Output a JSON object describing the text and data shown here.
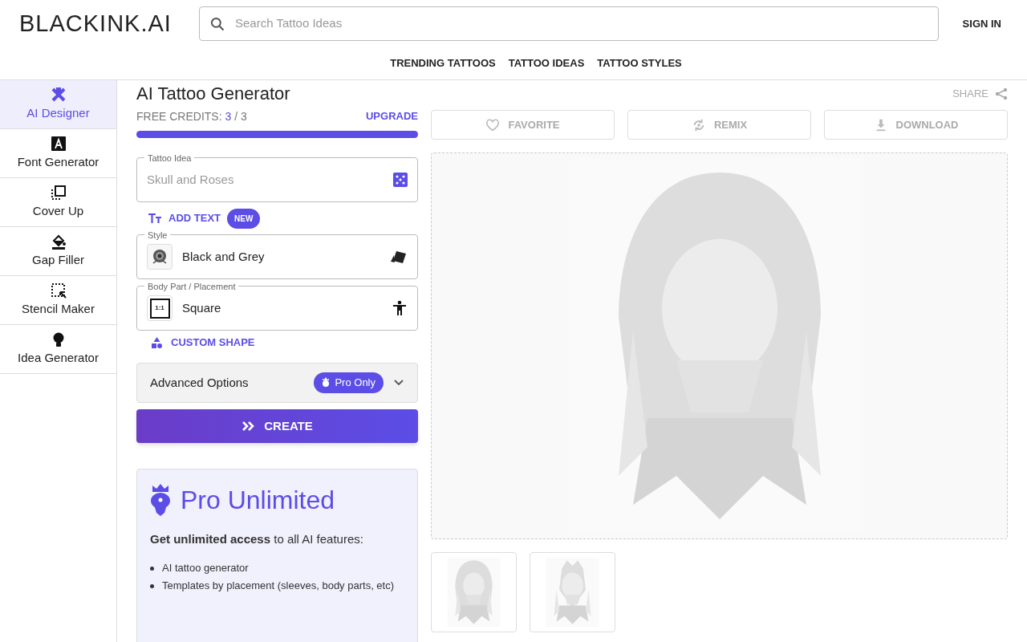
{
  "header": {
    "logo": "BLACK**INK**.AI",
    "search": {
      "placeholder": "Search Tattoo Ideas"
    },
    "sign_in": "SIGN IN",
    "nav": [
      "TRENDING TATTOOS",
      "TATTOO IDEAS",
      "TATTOO STYLES"
    ]
  },
  "sidebar": {
    "items": [
      {
        "label": "AI Designer",
        "selected": true
      },
      {
        "label": "Font Generator",
        "selected": false
      },
      {
        "label": "Cover Up",
        "selected": false
      },
      {
        "label": "Gap Filler",
        "selected": false
      },
      {
        "label": "Stencil Maker",
        "selected": false
      },
      {
        "label": "Idea Generator",
        "selected": false
      }
    ]
  },
  "title": "AI Tattoo Generator",
  "share": "SHARE",
  "credits": {
    "label": "FREE CREDITS:",
    "used": "3",
    "total": "/ 3",
    "level": 1,
    "upgrade": "UPGRADE"
  },
  "tattoo_idea": {
    "label": "Tattoo Idea",
    "placeholder": "Skull and Roses"
  },
  "add_text": {
    "label": "ADD TEXT",
    "badge": "NEW"
  },
  "style": {
    "label": "Style",
    "value": "Black and Grey"
  },
  "placement": {
    "label": "Body Part / Placement",
    "value": "Square",
    "thumb": "1:1"
  },
  "custom_shape": "CUSTOM SHAPE",
  "advanced": {
    "label": "Advanced Options",
    "badge": "Pro Only",
    "expanded": false
  },
  "create": "CREATE",
  "pro": {
    "title": "Pro Unlimited",
    "intro": "**Get unlimited access** to all AI features:",
    "features": [
      "AI tattoo generator",
      "Templates by placement (sleeves, body parts, etc)"
    ]
  },
  "actions": [
    {
      "label": "FAVORITE"
    },
    {
      "label": "REMIX"
    },
    {
      "label": "DOWNLOAD"
    }
  ]
}
